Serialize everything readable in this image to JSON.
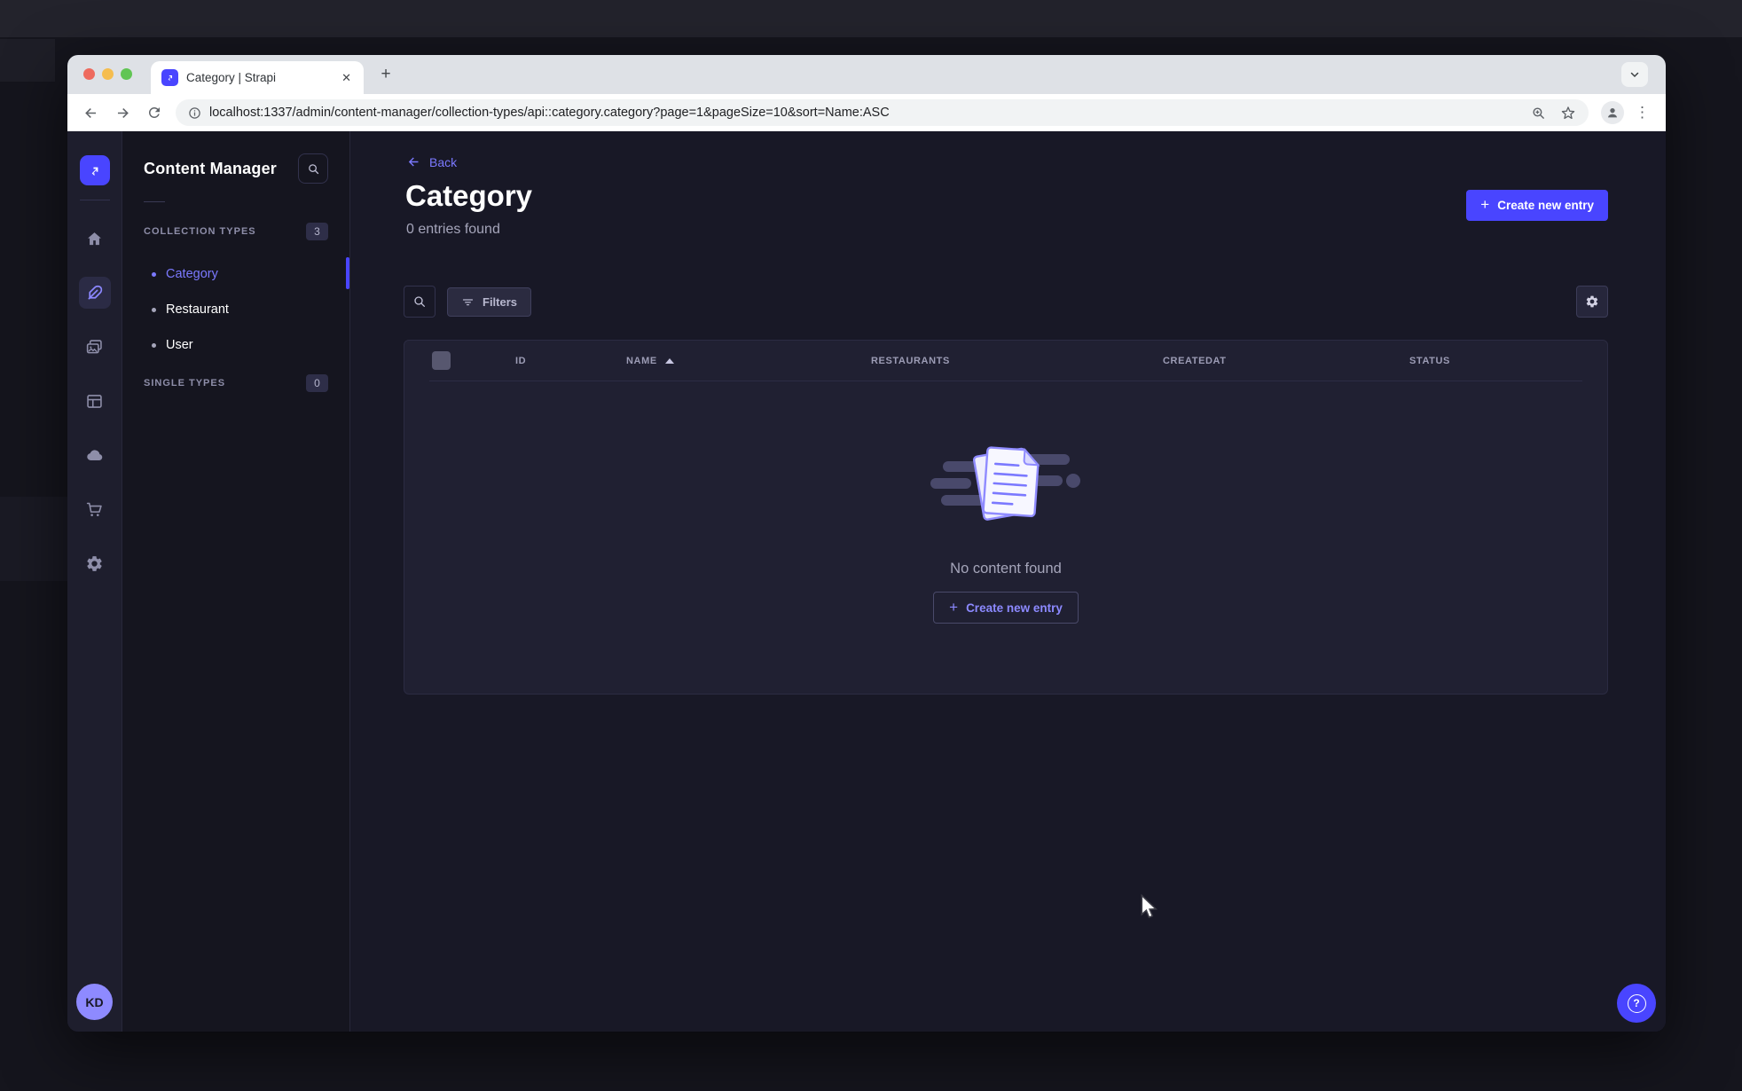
{
  "browser": {
    "tab_title": "Category | Strapi",
    "url": "localhost:1337/admin/content-manager/collection-types/api::category.category?page=1&pageSize=10&sort=Name:ASC"
  },
  "icons": {
    "close": "✕",
    "new_tab": "+",
    "menu_dots": "⋮",
    "plus": "+",
    "help": "?"
  },
  "colors": {
    "primary": "#4945ff",
    "primary_light": "#7b79ff",
    "page_bg": "#181826",
    "card_bg": "#202032"
  },
  "user": {
    "initials": "KD"
  },
  "subnav": {
    "title": "Content Manager",
    "sections": [
      {
        "label": "COLLECTION TYPES",
        "badge": "3",
        "items": [
          {
            "label": "Category",
            "active": true
          },
          {
            "label": "Restaurant",
            "active": false
          },
          {
            "label": "User",
            "active": false
          }
        ]
      },
      {
        "label": "SINGLE TYPES",
        "badge": "0",
        "items": []
      }
    ]
  },
  "main": {
    "back_label": "Back",
    "title": "Category",
    "entries_text": "0 entries found",
    "create_button_label": "Create new entry",
    "filters_label": "Filters",
    "table": {
      "columns": [
        "ID",
        "NAME",
        "RESTAURANTS",
        "CREATEDAT",
        "STATUS"
      ],
      "sorted_by": "NAME",
      "sort_direction": "ASC",
      "rows": []
    },
    "empty_state": {
      "message": "No content found",
      "create_button_label": "Create new entry"
    }
  }
}
